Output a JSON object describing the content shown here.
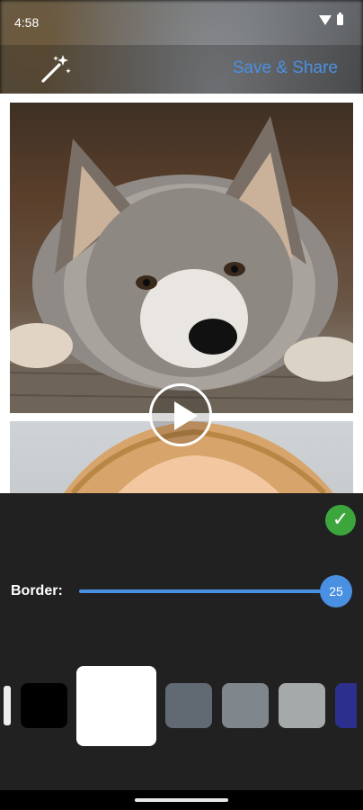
{
  "status_bar": {
    "time": "4:58",
    "wifi_icon": "wifi-icon",
    "battery_icon": "battery-icon"
  },
  "toolbar": {
    "magic_icon": "magic-wand-icon",
    "share_label": "Save & Share",
    "accent": "#4a90e2"
  },
  "collage": {
    "play_icon": "play-icon",
    "border_color": "#ffffff"
  },
  "panel": {
    "confirm_icon": "check-icon",
    "confirm_glyph": "✓",
    "confirm_color": "#3ca63c",
    "border_label": "Border:",
    "border_value": "25",
    "slider_color": "#4a90e2"
  },
  "swatches": [
    {
      "color": "#eeeeee",
      "selected": false
    },
    {
      "color": "#000000",
      "selected": false
    },
    {
      "color": "#ffffff",
      "selected": true
    },
    {
      "color": "#616a73",
      "selected": false
    },
    {
      "color": "#7f878c",
      "selected": false
    },
    {
      "color": "#a6a9aa",
      "selected": false
    },
    {
      "color": "#2d2f8e",
      "selected": false
    }
  ]
}
